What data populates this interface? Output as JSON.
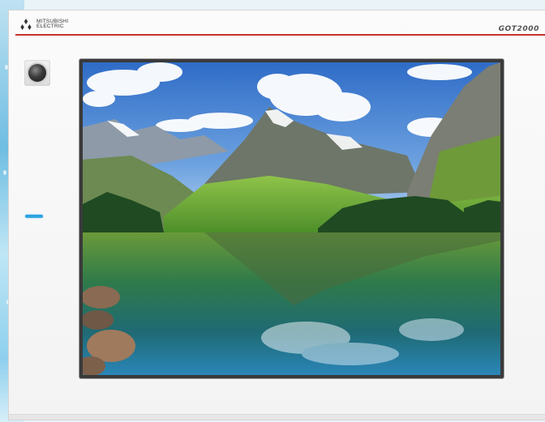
{
  "brand": {
    "name_line1": "MITSUBISHI",
    "name_line2": "ELECTRIC",
    "logo_icon": "three-diamond-icon",
    "color": "#c8322b"
  },
  "device": {
    "model": "GOT2000",
    "accent_line_color": "#c8322b",
    "status_led_color": "#2fa3e0"
  },
  "screen": {
    "content": "mountain-lake-wallpaper-image"
  }
}
